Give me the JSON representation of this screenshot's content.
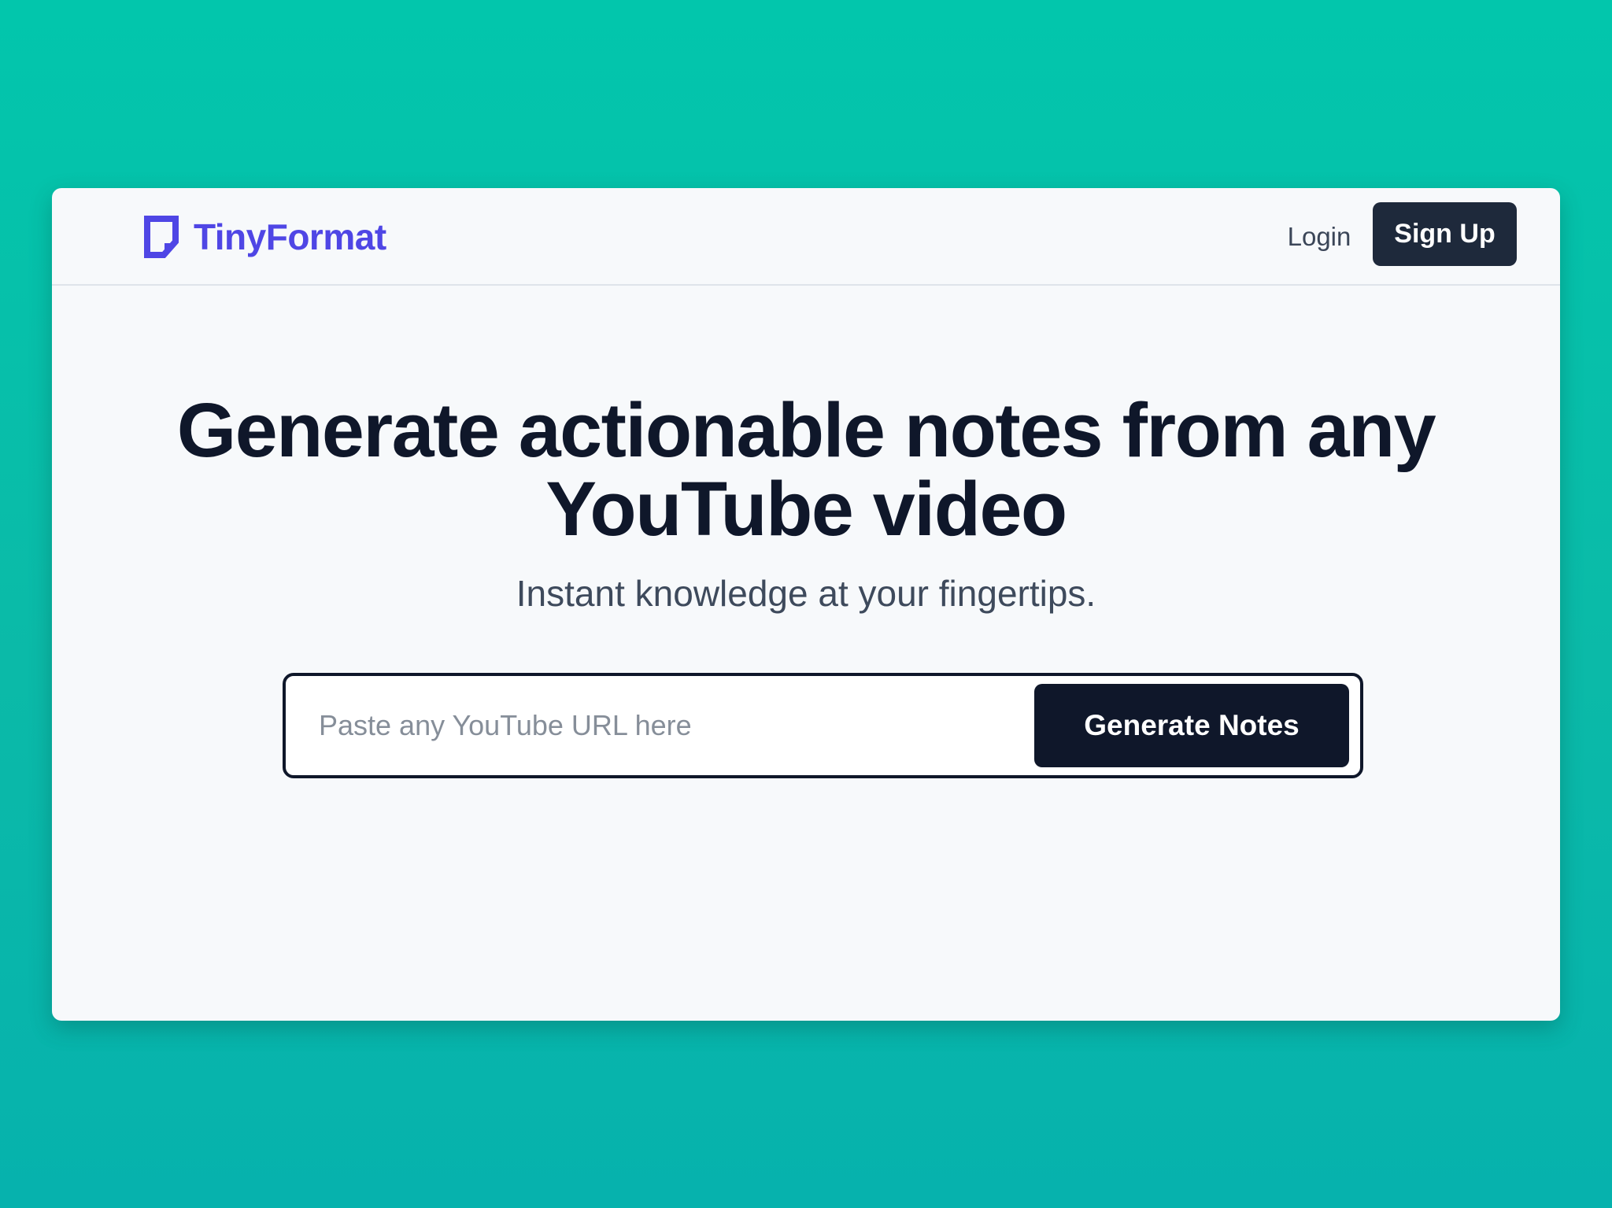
{
  "header": {
    "brand_name": "TinyFormat",
    "brand_icon": "note-icon",
    "login_label": "Login",
    "signup_label": "Sign Up"
  },
  "hero": {
    "title_line1": "Generate actionable notes from any",
    "title_line2": "YouTube video",
    "subtitle": "Instant knowledge at your fingertips."
  },
  "form": {
    "url_value": "",
    "url_placeholder": "Paste any YouTube URL here",
    "submit_label": "Generate Notes"
  },
  "colors": {
    "brand": "#4f46e5",
    "dark": "#0f172a",
    "signup_bg": "#1e293b",
    "background": "#02c6ac"
  }
}
